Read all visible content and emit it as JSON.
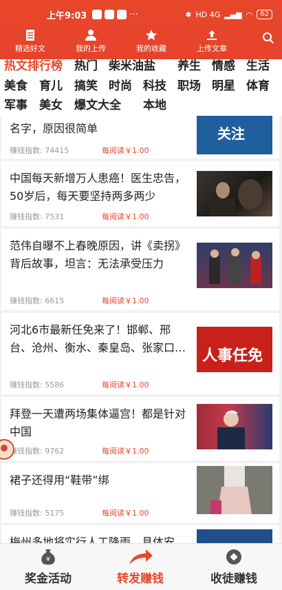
{
  "status": {
    "time": "上午9:03",
    "battery": "62",
    "net": "HD 4G"
  },
  "nav": {
    "items": [
      {
        "label": "精选好文"
      },
      {
        "label": "我的上传"
      },
      {
        "label": "我的收藏"
      },
      {
        "label": "上传文章"
      }
    ]
  },
  "categories": {
    "active": "热文排行榜",
    "items": [
      "热门",
      "柴米油盐",
      "养生",
      "情感",
      "生活",
      "美食",
      "育儿",
      "搞笑",
      "时尚",
      "科技",
      "职场",
      "明星",
      "体育",
      "军事",
      "美女",
      "爆文大全",
      "本地"
    ]
  },
  "articles": [
    {
      "title": "名字，原因很简单",
      "score_label": "赚钱指数: 74415",
      "rate": "每阅读￥1.00",
      "thumb_text": "关注"
    },
    {
      "title": "中国每天新增万人患癌！医生忠告，50岁后，每天要坚持两多两少",
      "score_label": "赚钱指数: 7531",
      "rate": "每阅读￥1.00"
    },
    {
      "title": "范伟自曝不上春晚原因，讲《卖拐》背后故事，坦言：无法承受压力",
      "score_label": "赚钱指数: 6615",
      "rate": "每阅读￥1.00"
    },
    {
      "title": "河北6市最新任免来了！邯郸、邢台、沧州、衡水、秦皇岛、张家口…",
      "score_label": "赚钱指数: 5586",
      "rate": "每阅读￥1.00",
      "thumb_text": "人事任免"
    },
    {
      "title": "拜登一天遭两场集体逼宫！都是针对中国",
      "score_label": "赚钱指数: 9762",
      "rate": "每阅读￥1.00"
    },
    {
      "title": "裙子还得用“鞋带”绑",
      "score_label": "赚钱指数: 5175",
      "rate": "每阅读￥1.00"
    },
    {
      "title": "梅州多地将实行人工降雨，具体安"
    }
  ],
  "bottom_tabs": [
    {
      "label": "奖金活动"
    },
    {
      "label": "转发赚钱"
    },
    {
      "label": "收徒赚钱"
    }
  ],
  "colors": {
    "accent": "#e8472b",
    "text": "#222222",
    "muted": "#999999"
  }
}
